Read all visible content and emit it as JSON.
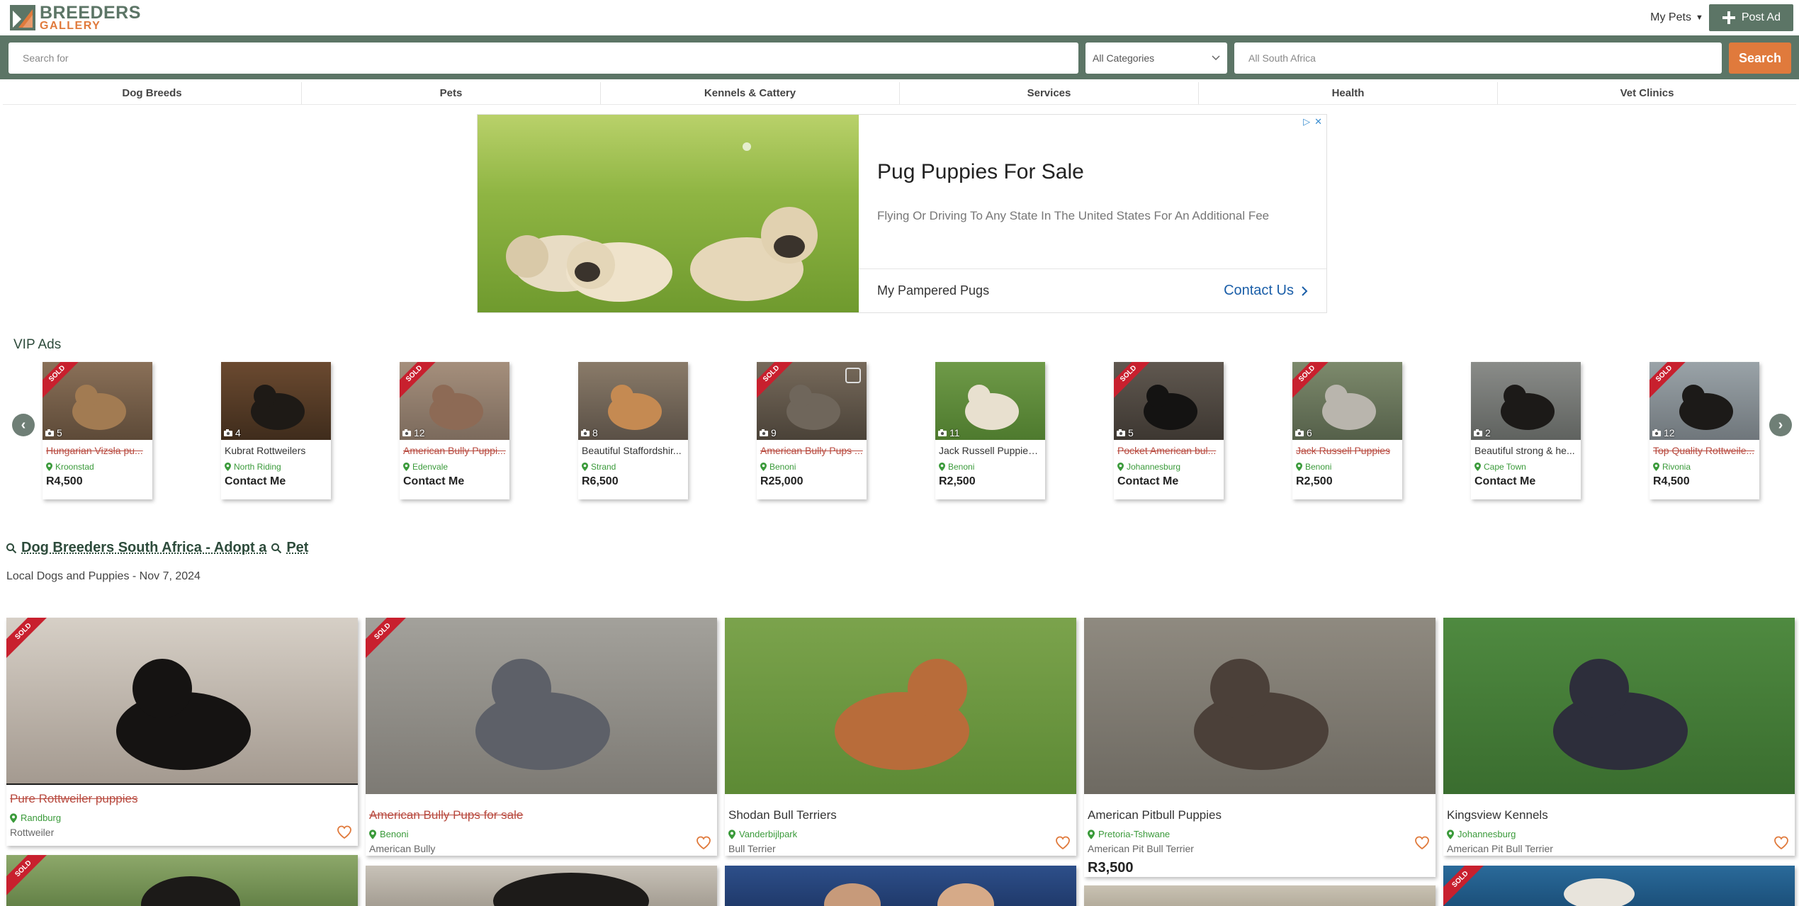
{
  "header": {
    "logo_line1": "BREEDERS",
    "logo_line2": "GALLERY",
    "my_pets_label": "My Pets",
    "post_ad_label": "Post Ad"
  },
  "search": {
    "placeholder": "Search for",
    "category_value": "All Categories",
    "location_placeholder": "All South Africa",
    "button_label": "Search"
  },
  "nav": [
    "Dog Breeds",
    "Pets",
    "Kennels & Cattery",
    "Services",
    "Health",
    "Vet Clinics"
  ],
  "ad": {
    "title": "Pug Puppies For Sale",
    "description": "Flying Or Driving To Any State In The United States For An Additional Fee",
    "advertiser": "My Pampered Pugs",
    "cta": "Contact Us"
  },
  "vip": {
    "title": "VIP Ads",
    "items": [
      {
        "title": "Hungarian Vizsla pu...",
        "location": "Kroonstad",
        "price": "R4,500",
        "photos": "5",
        "sold": true
      },
      {
        "title": "Kubrat Rottweilers",
        "location": "North Riding",
        "price": "Contact Me",
        "photos": "4",
        "sold": false
      },
      {
        "title": "American Bully Puppi...",
        "location": "Edenvale",
        "price": "Contact Me",
        "photos": "12",
        "sold": true
      },
      {
        "title": "Beautiful Staffordshir...",
        "location": "Strand",
        "price": "R6,500",
        "photos": "8",
        "sold": false
      },
      {
        "title": "American Bully Pups ...",
        "location": "Benoni",
        "price": "R25,000",
        "photos": "9",
        "sold": true
      },
      {
        "title": "Jack Russell Puppies ...",
        "location": "Benoni",
        "price": "R2,500",
        "photos": "11",
        "sold": false
      },
      {
        "title": "Pocket American bul...",
        "location": "Johannesburg",
        "price": "Contact Me",
        "photos": "5",
        "sold": true
      },
      {
        "title": "Jack Russell Puppies",
        "location": "Benoni",
        "price": "R2,500",
        "photos": "6",
        "sold": true
      },
      {
        "title": "Beautiful strong & he...",
        "location": "Cape Town",
        "price": "Contact Me",
        "photos": "2",
        "sold": false
      },
      {
        "title": "Top Quality Rottweile...",
        "location": "Rivonia",
        "price": "R4,500",
        "photos": "12",
        "sold": true
      }
    ]
  },
  "heading": {
    "part1": "Dog Breeders South Africa - Adopt a",
    "part2": "Pet",
    "subtitle": "Local Dogs and Puppies - Nov 7, 2024"
  },
  "sold_label": "SOLD",
  "listings": [
    {
      "title": "Pure Rottweiler puppies",
      "location": "Randburg",
      "breed": "Rottweiler",
      "price": "",
      "sold": true
    },
    {
      "title": "American Bully Pups for sale",
      "location": "Benoni",
      "breed": "American Bully",
      "price": "",
      "sold": true
    },
    {
      "title": "Shodan Bull Terriers",
      "location": "Vanderbijlpark",
      "breed": "Bull Terrier",
      "price": "",
      "sold": false
    },
    {
      "title": "American Pitbull Puppies",
      "location": "Pretoria-Tshwane",
      "breed": "American Pit Bull Terrier",
      "price": "R3,500",
      "sold": false
    },
    {
      "title": "Kingsview Kennels",
      "location": "Johannesburg",
      "breed": "American Pit Bull Terrier",
      "price": "",
      "sold": false
    }
  ],
  "colors": {
    "brand_green": "#5c7566",
    "accent_orange": "#e07a3c",
    "sold_red": "#c8202e",
    "location_green": "#3a9a3a"
  },
  "icons": {
    "logo": "breeders-gallery-logo-icon",
    "plus": "plus-icon",
    "chevron": "chevron-down-icon",
    "camera": "camera-icon",
    "pin": "map-pin-icon",
    "heart": "heart-icon",
    "search": "search-icon"
  }
}
